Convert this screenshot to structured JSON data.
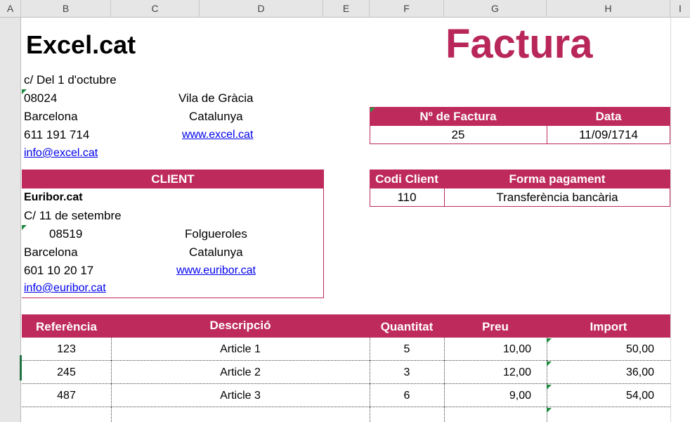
{
  "columns": [
    "A",
    "B",
    "C",
    "D",
    "E",
    "F",
    "G",
    "H",
    "I"
  ],
  "company": {
    "name": "Excel.cat",
    "street": "c/ Del 1 d'octubre",
    "zip": "08024",
    "district": "Vila de Gràcia",
    "city": "Barcelona",
    "region": "Catalunya",
    "phone": "611 191 714",
    "web": "www.excel.cat",
    "email": "info@excel.cat"
  },
  "doc_title": "Factura",
  "invoice": {
    "number_label": "Nº de Factura",
    "date_label": "Data",
    "number": "25",
    "date": "11/09/1714",
    "client_code_label": "Codi Client",
    "payment_label": "Forma pagament",
    "client_code": "110",
    "payment": "Transferència bancària"
  },
  "client": {
    "header": "CLIENT",
    "name": "Euribor.cat",
    "street": "C/ 11 de setembre",
    "zip": "08519",
    "town": "Folgueroles",
    "city": "Barcelona",
    "region": "Catalunya",
    "phone": "601 10 20 17",
    "web": "www.euribor.cat",
    "email": "info@euribor.cat"
  },
  "table": {
    "headers": [
      "Referència",
      "Descripció",
      "Quantitat",
      "Preu",
      "Import"
    ],
    "rows": [
      [
        "123",
        "Article 1",
        "5",
        "10,00",
        "50,00"
      ],
      [
        "245",
        "Article 2",
        "3",
        "12,00",
        "36,00"
      ],
      [
        "487",
        "Article 3",
        "6",
        "9,00",
        "54,00"
      ]
    ],
    "partial_last": "-"
  },
  "colors": {
    "accent": "#be2a5c",
    "title": "#b8265a",
    "link": "#0000ee"
  }
}
